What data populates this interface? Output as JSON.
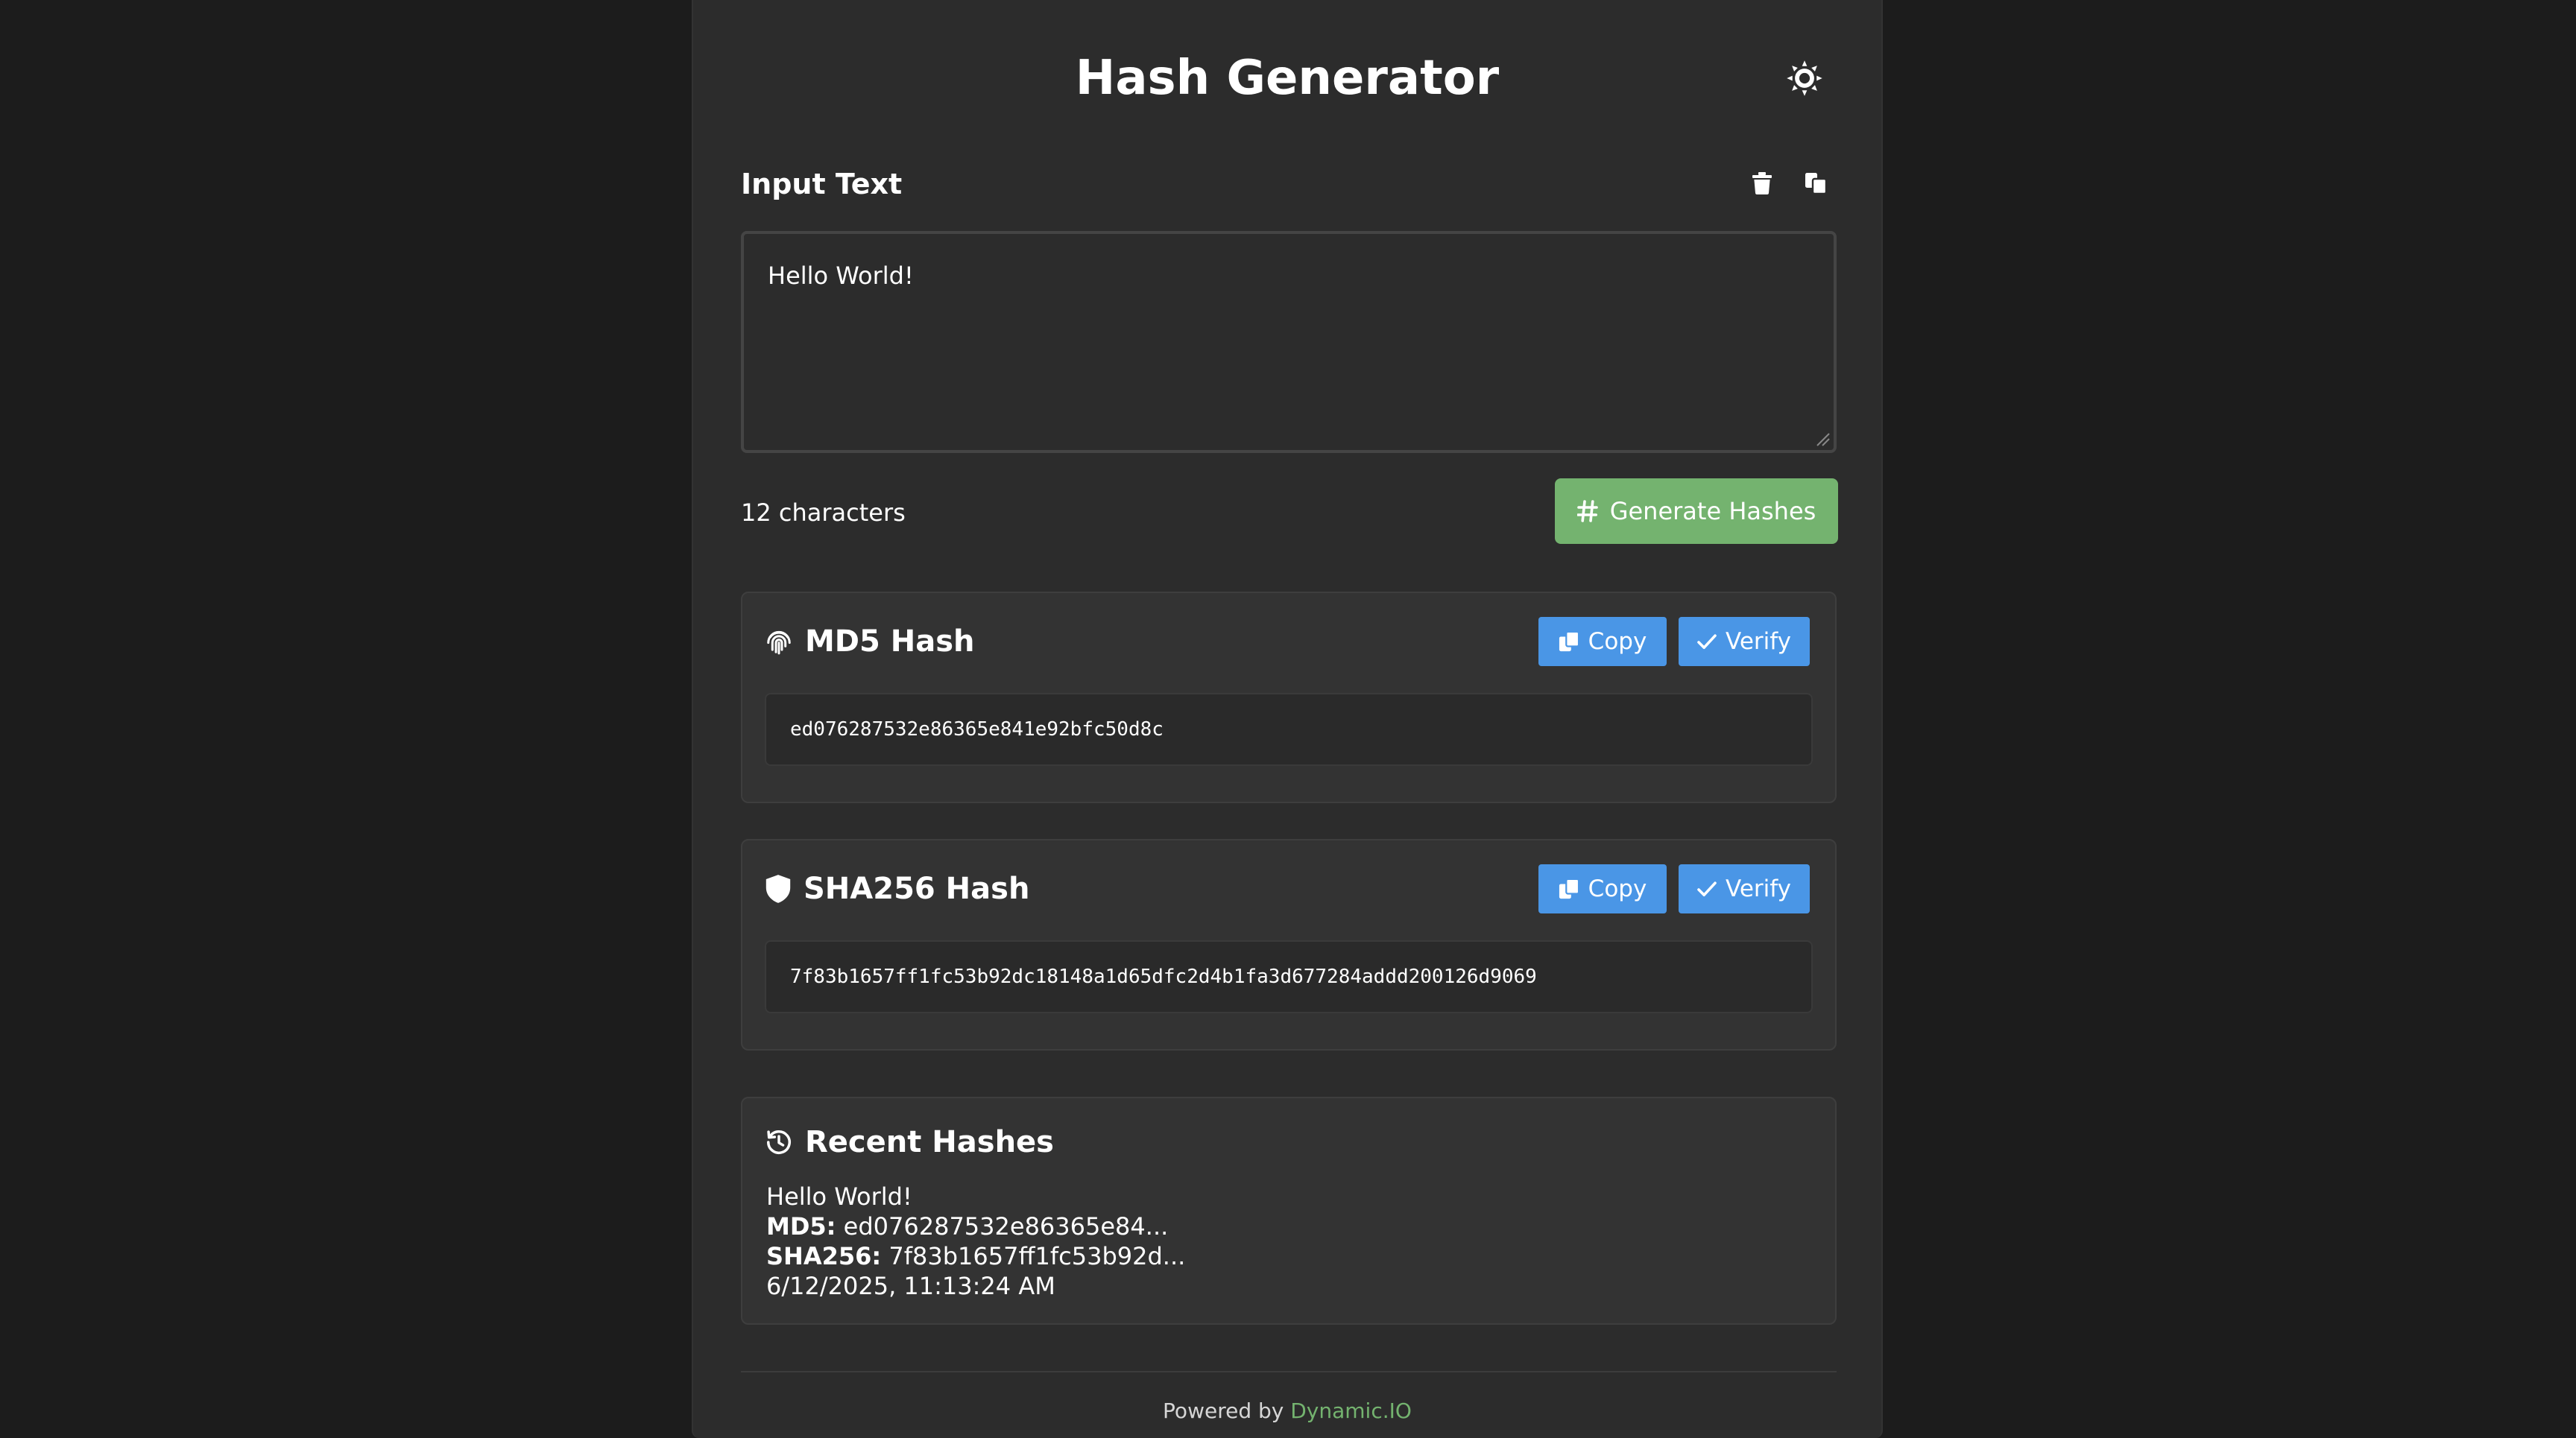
{
  "app": {
    "title": "Hash Generator",
    "theme_toggle_icon": "sun-icon"
  },
  "input": {
    "label": "Input Text",
    "clear_icon": "trash-icon",
    "paste_icon": "paste-icon",
    "value": "Hello World!",
    "char_count": "12 characters",
    "generate_label": "Generate Hashes"
  },
  "md5": {
    "title": "MD5 Hash",
    "icon": "fingerprint-icon",
    "copy_label": "Copy",
    "verify_label": "Verify",
    "value": "ed076287532e86365e841e92bfc50d8c"
  },
  "sha256": {
    "title": "SHA256 Hash",
    "icon": "shield-icon",
    "copy_label": "Copy",
    "verify_label": "Verify",
    "value": "7f83b1657ff1fc53b92dc18148a1d65dfc2d4b1fa3d677284addd200126d9069"
  },
  "recent": {
    "title": "Recent Hashes",
    "icon": "history-icon",
    "entries": [
      {
        "text": "Hello World!",
        "md5_label": "MD5:",
        "md5_value": "ed076287532e86365e84...",
        "sha256_label": "SHA256:",
        "sha256_value": "7f83b1657ff1fc53b92d...",
        "timestamp": "6/12/2025, 11:13:24 AM"
      }
    ]
  },
  "footer": {
    "prefix": "Powered by",
    "link": "Dynamic.IO"
  },
  "colors": {
    "background": "#1c1c1c",
    "card": "#2c2c2c",
    "primary_green": "#74b36f",
    "button_blue": "#4a96e6"
  }
}
